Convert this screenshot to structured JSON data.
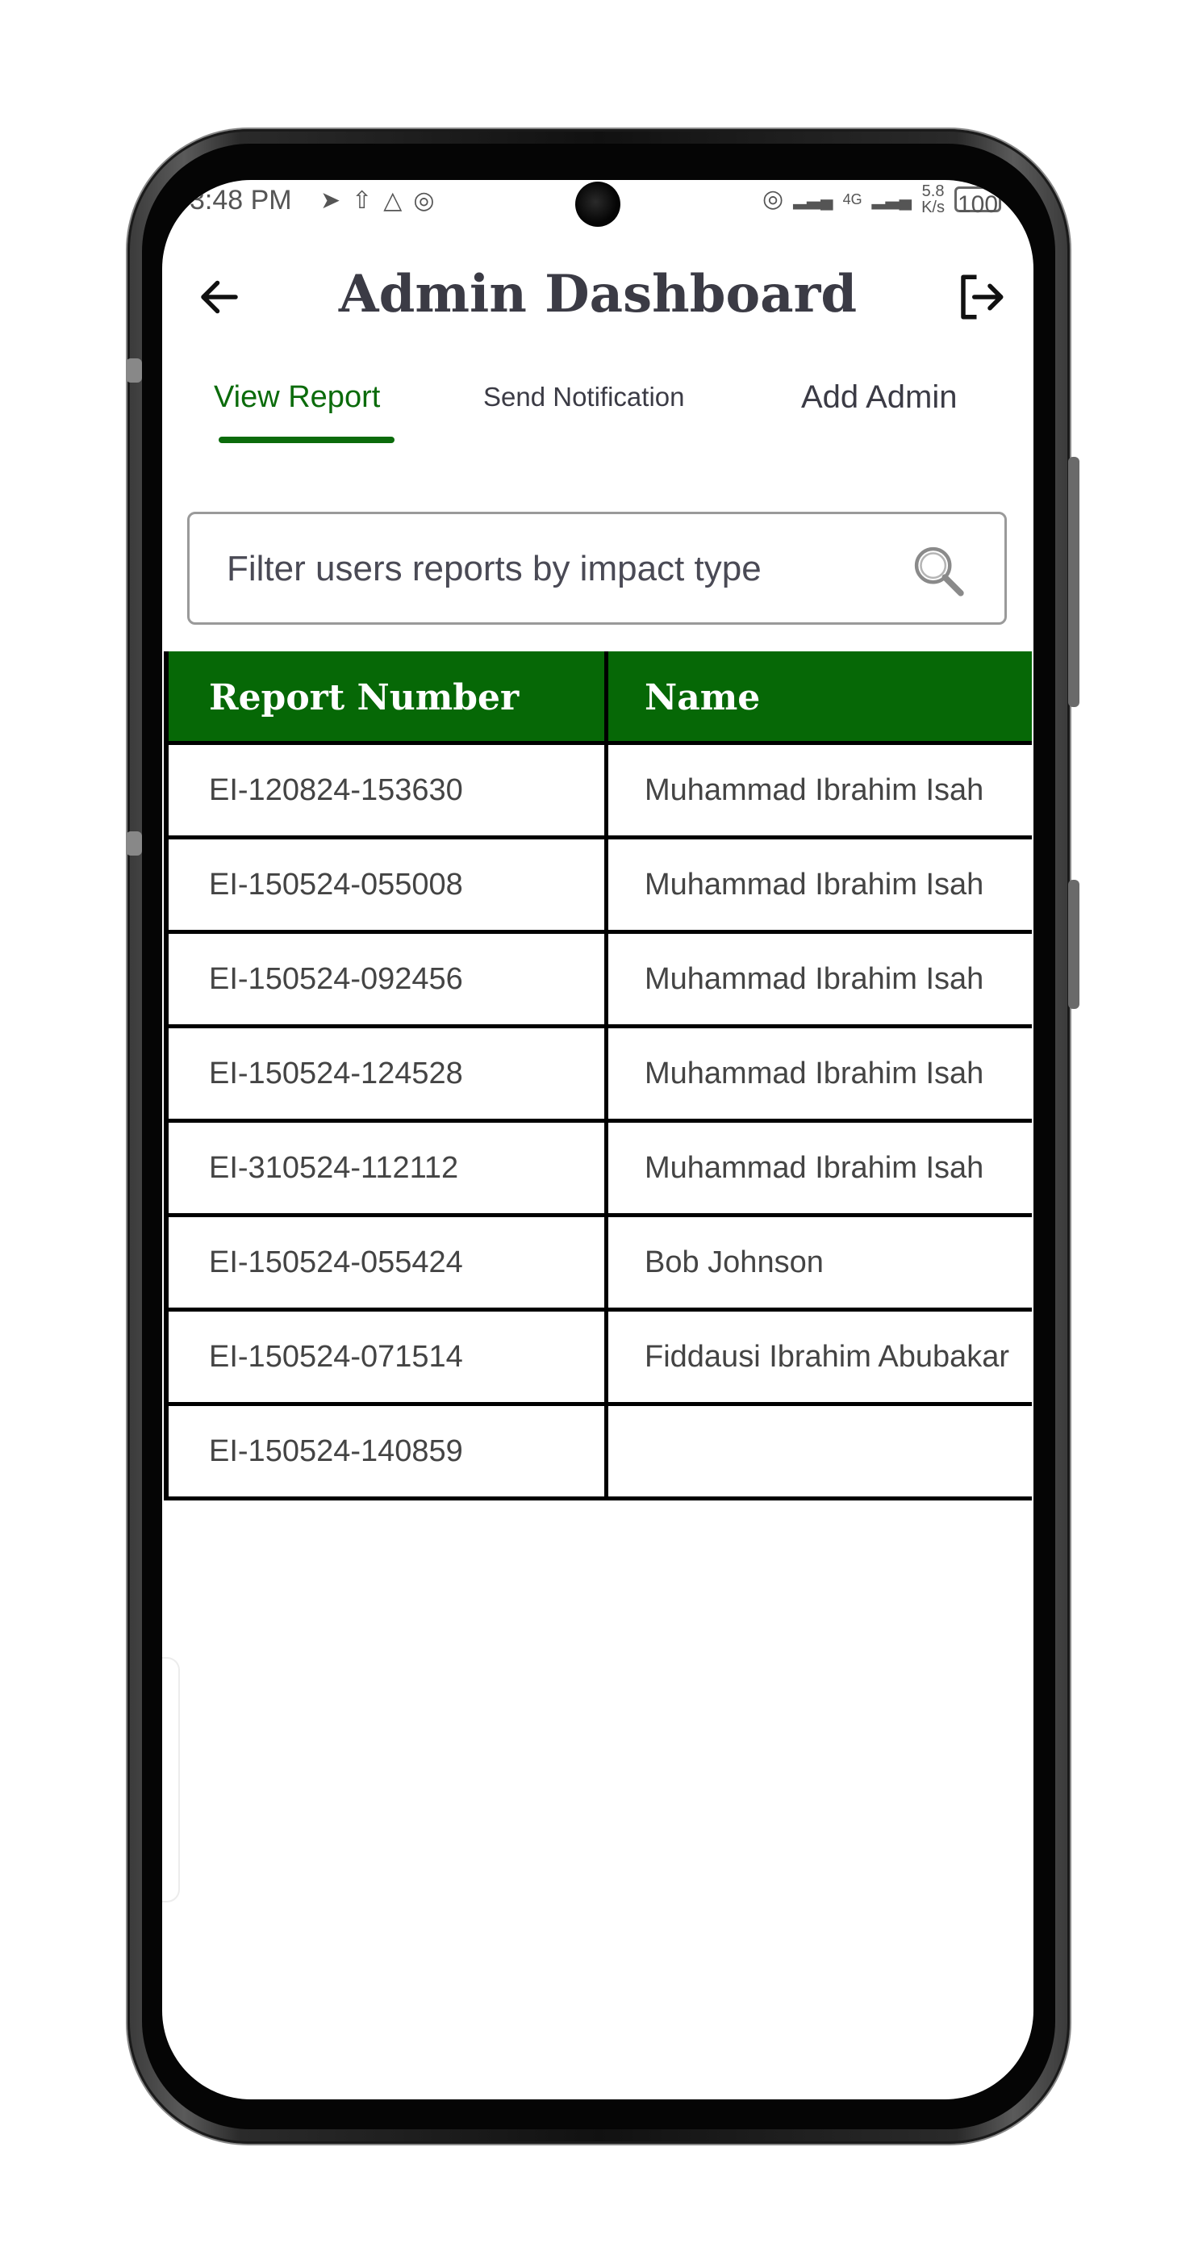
{
  "status_bar": {
    "time": "3:48 PM",
    "left_icons": [
      "telegram-icon",
      "upload-icon",
      "drive-icon",
      "hotspot-icon"
    ],
    "network_type": "4G",
    "net_speed": "5.8",
    "net_speed_unit": "K/s",
    "battery": "100"
  },
  "app_bar": {
    "title": "Admin Dashboard",
    "back_icon": "arrow-left-icon",
    "logout_icon": "logout-icon"
  },
  "tabs": [
    {
      "label": "View Report",
      "selected": true
    },
    {
      "label": "Send Notification",
      "selected": false
    },
    {
      "label": "Add Admin",
      "selected": false
    }
  ],
  "search": {
    "placeholder": "Filter users reports by impact type",
    "value": "",
    "icon": "search-icon"
  },
  "table": {
    "columns": [
      "Report Number",
      "Name"
    ],
    "rows": [
      {
        "report_number": "EI-120824-153630",
        "name": "Muhammad Ibrahim Isah"
      },
      {
        "report_number": "EI-150524-055008",
        "name": "Muhammad Ibrahim Isah"
      },
      {
        "report_number": "EI-150524-092456",
        "name": "Muhammad Ibrahim Isah"
      },
      {
        "report_number": "EI-150524-124528",
        "name": "Muhammad Ibrahim Isah"
      },
      {
        "report_number": "EI-310524-112112",
        "name": "Muhammad Ibrahim Isah"
      },
      {
        "report_number": "EI-150524-055424",
        "name": "Bob Johnson"
      },
      {
        "report_number": "EI-150524-071514",
        "name": "Fiddausi Ibrahim Abubakar"
      },
      {
        "report_number": "EI-150524-140859",
        "name": ""
      }
    ]
  },
  "colors": {
    "accent": "#0b6b0b",
    "header_bg": "#066806",
    "title_text": "#3b3b45"
  }
}
